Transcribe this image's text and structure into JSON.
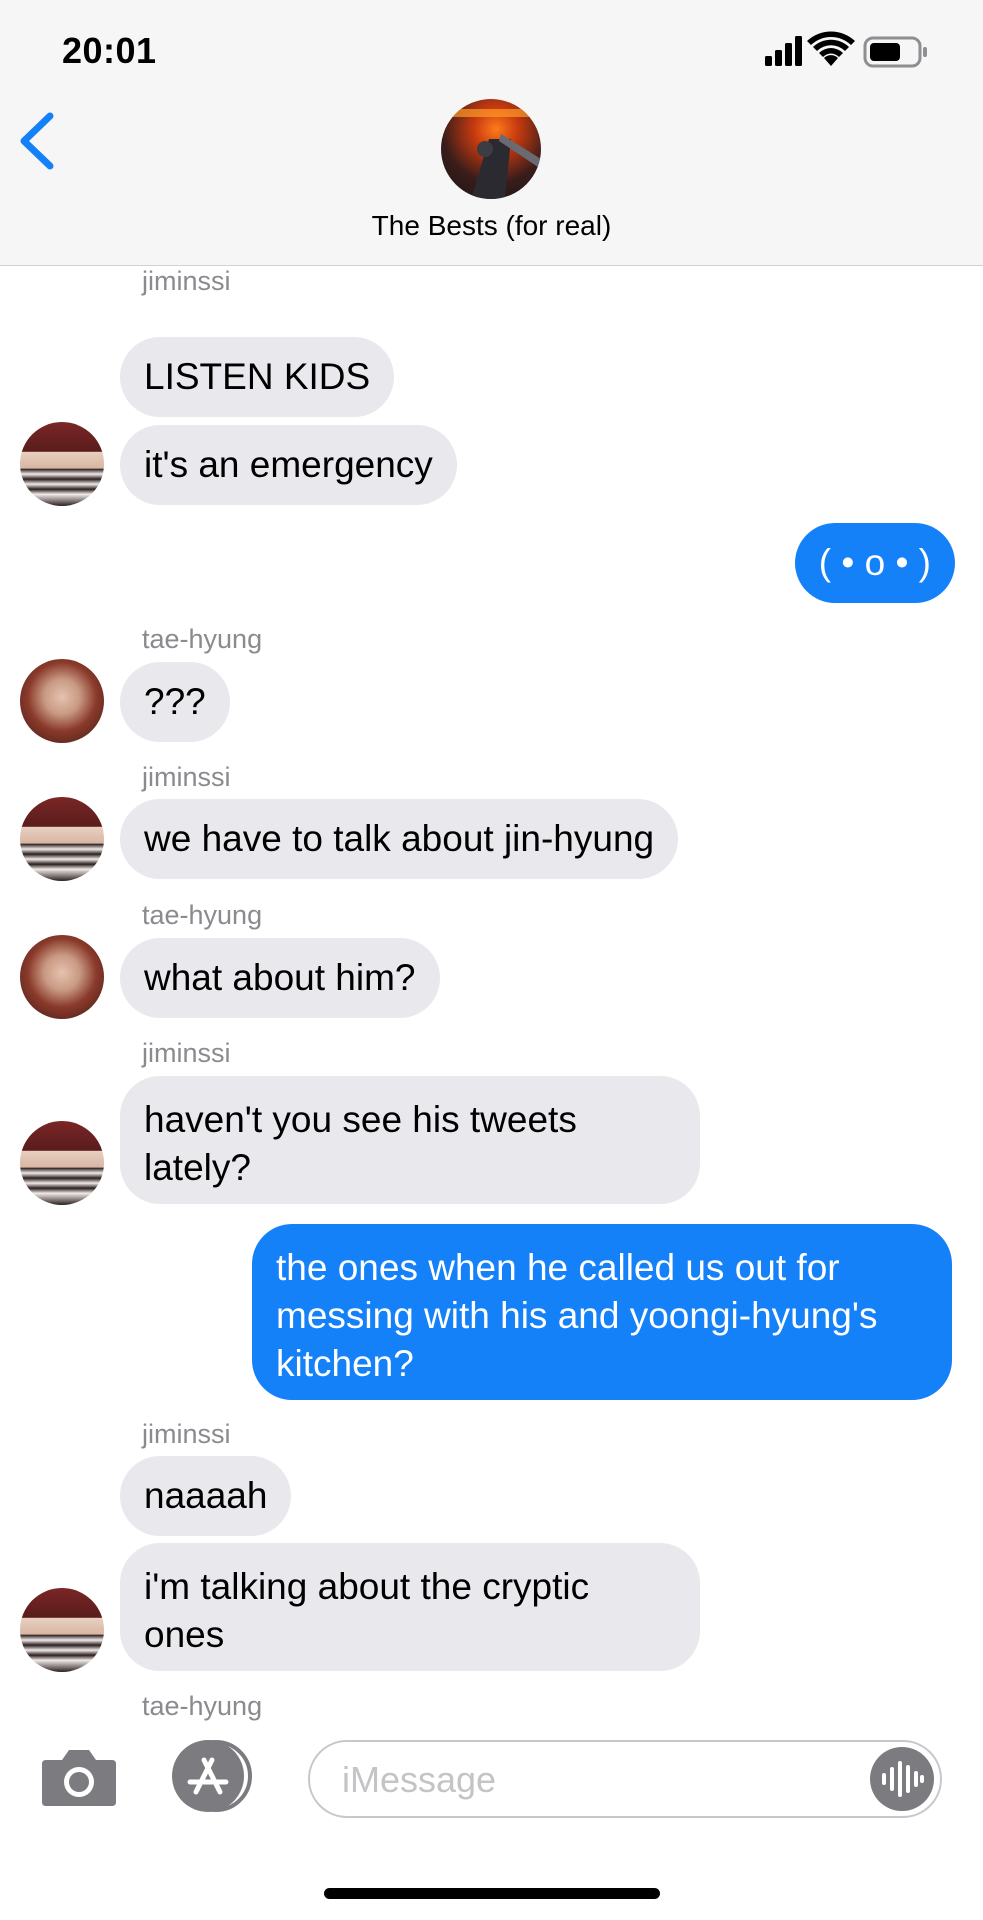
{
  "status_bar": {
    "time": "20:01"
  },
  "header": {
    "title": "The Bests (for real)"
  },
  "messages": [
    {
      "name": "jiminssi",
      "text": "LISTEN KIDS"
    },
    {
      "text": "it's an emergency"
    },
    {
      "text": "( • o • )"
    },
    {
      "name": "tae-hyung",
      "text": "???"
    },
    {
      "name": "jiminssi",
      "text": "we have to talk about jin-hyung"
    },
    {
      "name": "tae-hyung",
      "text": "what about him?"
    },
    {
      "name": "jiminssi",
      "text": "haven't you see his tweets lately?"
    },
    {
      "text": "the ones when he called us out for messing with his and yoongi-hyung's kitchen?"
    },
    {
      "name": "jiminssi",
      "text": "naaaah"
    },
    {
      "text": "i'm talking about the cryptic ones"
    },
    {
      "name": "tae-hyung"
    }
  ],
  "input": {
    "placeholder": "iMessage"
  },
  "colors": {
    "sent_bubble": "#1481f9",
    "received_bubble": "#e8e8ed",
    "accent": "#1481f9"
  }
}
